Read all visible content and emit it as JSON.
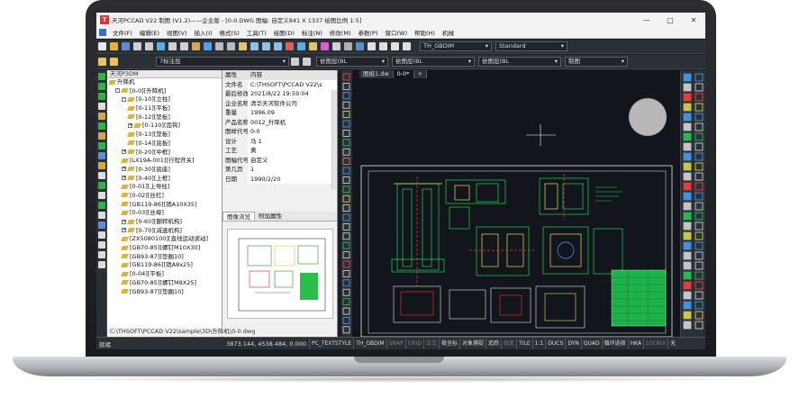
{
  "window": {
    "title": "天河PCCAD V22 制图 (V1.2)——企业版 - [0-0.DWG 图幅: 自定义841 X 1337 绘图比例 1:5]",
    "logo": "T"
  },
  "menubar": {
    "items": [
      "文件(F)",
      "编辑(E)",
      "视图(V)",
      "插入(I)",
      "格式(S)",
      "工具(T)",
      "绘图(D)",
      "标注(N)",
      "修改(M)",
      "参数(P)",
      "窗口(W)",
      "帮助(H)",
      "机械"
    ]
  },
  "toolbar1": {
    "textstyle_combo": "TH_GBDIM",
    "dimstyle_combo": "Standard"
  },
  "toolbar2": {
    "layer_combo": "7标注层",
    "color_combo": "依图层(BL",
    "linetype_combo": "依图层(BL",
    "lineweight_combo": "依图层(BL",
    "plotstyle_combo": "制图"
  },
  "tree_panel": {
    "title": "天河P3DM",
    "rows": [
      {
        "label": "升降机",
        "depth": 0,
        "expander": ""
      },
      {
        "label": "[0-0][升降机]",
        "depth": 1,
        "expander": "-"
      },
      {
        "label": "[0-10][立柱]",
        "depth": 2,
        "expander": "-"
      },
      {
        "label": "[0-11][平板]",
        "depth": 3,
        "expander": ""
      },
      {
        "label": "[0-12][垫板]",
        "depth": 3,
        "expander": ""
      },
      {
        "label": "[0-110][齿钩]",
        "depth": 3,
        "expander": "+"
      },
      {
        "label": "[0-13][垫板]",
        "depth": 3,
        "expander": ""
      },
      {
        "label": "[0-14][底板]",
        "depth": 3,
        "expander": ""
      },
      {
        "label": "[0-20][中框]",
        "depth": 2,
        "expander": "+"
      },
      {
        "label": "[LX19A-001][行程开关]",
        "depth": 2,
        "expander": ""
      },
      {
        "label": "[0-30][底座]",
        "depth": 2,
        "expander": "+"
      },
      {
        "label": "[0-40][上框]",
        "depth": 2,
        "expander": "+"
      },
      {
        "label": "[0-01][上导柱]",
        "depth": 2,
        "expander": ""
      },
      {
        "label": "[0-02][丝杠]",
        "depth": 2,
        "expander": ""
      },
      {
        "label": "[GB119-86][销A10X35]",
        "depth": 2,
        "expander": ""
      },
      {
        "label": "[0-03][丝母]",
        "depth": 2,
        "expander": ""
      },
      {
        "label": "[0-60][翻转机构]",
        "depth": 2,
        "expander": "+"
      },
      {
        "label": "[0-70][减速机构]",
        "depth": 2,
        "expander": "+"
      },
      {
        "label": "[ZX5080100][直线运动滚动]",
        "depth": 2,
        "expander": ""
      },
      {
        "label": "[GB70-85][螺钉M10X30]",
        "depth": 2,
        "expander": ""
      },
      {
        "label": "[GB93-87][垫圈10]",
        "depth": 2,
        "expander": ""
      },
      {
        "label": "[GB119-86][销A8x25]",
        "depth": 2,
        "expander": ""
      },
      {
        "label": "[0-04][平板]",
        "depth": 2,
        "expander": ""
      },
      {
        "label": "[GB70-85][螺钉M8X25]",
        "depth": 2,
        "expander": ""
      },
      {
        "label": "[GB93-87][垫圈10]",
        "depth": 2,
        "expander": ""
      }
    ]
  },
  "prop_panel": {
    "rows": [
      {
        "key": "属性",
        "value": "内容"
      },
      {
        "key": "文件名",
        "value": "C:\\THSOFT\\PCCAD V22\\s"
      },
      {
        "key": "最后修改...",
        "value": "2021/8/22 19:59:04"
      },
      {
        "key": "企业名称",
        "value": "清华天河软件公司"
      },
      {
        "key": "重量",
        "value": "1996.09"
      },
      {
        "key": "产品名称...",
        "value": "0012_升降机"
      },
      {
        "key": "图样代号",
        "value": "0-0"
      },
      {
        "key": "设计",
        "value": "马 1"
      },
      {
        "key": "工艺",
        "value": "黄"
      },
      {
        "key": "图幅代号",
        "value": "自定义"
      },
      {
        "key": "第几页",
        "value": "1"
      },
      {
        "key": "日期",
        "value": "1990/2/20"
      }
    ],
    "tabs": [
      "图像浏览",
      "附加属性"
    ]
  },
  "drawing": {
    "tabs": [
      "图纸1.dw",
      "0-0*",
      "+"
    ],
    "command_line": "C:\\THSOFT\\PCCAD V22\\sample\\3D\\升降机\\0-0.dwg"
  },
  "statusbar": {
    "left_text": "就绪",
    "coordinates": "3873.144, 4538.484, 0.000",
    "buttons": [
      {
        "label": "PC_TEXTSTYLE",
        "on": true
      },
      {
        "label": "TH_GBDIM",
        "on": true
      },
      {
        "label": "SNAP",
        "on": false
      },
      {
        "label": "GRID",
        "on": false
      },
      {
        "label": "正交",
        "on": false
      },
      {
        "label": "极坐标",
        "on": true
      },
      {
        "label": "对象捕捉",
        "on": true
      },
      {
        "label": "追踪",
        "on": true
      },
      {
        "label": "线宽",
        "on": false
      },
      {
        "label": "TILE",
        "on": true
      },
      {
        "label": "1:1",
        "on": true
      },
      {
        "label": "DUCS",
        "on": true
      },
      {
        "label": "DYN",
        "on": true
      },
      {
        "label": "QUAD",
        "on": true
      },
      {
        "label": "循环选择",
        "on": true
      },
      {
        "label": "HKA",
        "on": true
      },
      {
        "label": "LOCKUI",
        "on": false
      },
      {
        "label": "无",
        "on": true
      }
    ]
  },
  "colors": {
    "drawing_background": "#12151b",
    "ui_dark": "#2b2f36",
    "frame_line": "#e8e8e8",
    "accent_cyan": "#00e5ff",
    "accent_green": "#24d35a",
    "accent_yellow": "#e6e24a",
    "accent_red": "#ff3030"
  }
}
